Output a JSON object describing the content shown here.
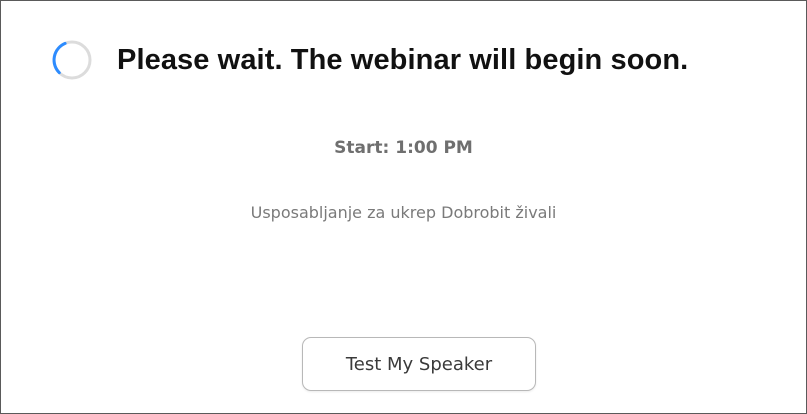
{
  "waiting_room": {
    "title": "Please wait. The webinar will begin soon.",
    "start_time": "Start: 1:00 PM",
    "topic": "Usposabljanje za ukrep Dobrobit živali",
    "test_speaker_label": "Test My Speaker",
    "spinner_icon": "loading-spinner-icon"
  },
  "colors": {
    "spinner_track": "#dcdcdc",
    "spinner_arc": "#2d8cff",
    "title": "#111111",
    "secondary_text": "#6f6f6f"
  }
}
